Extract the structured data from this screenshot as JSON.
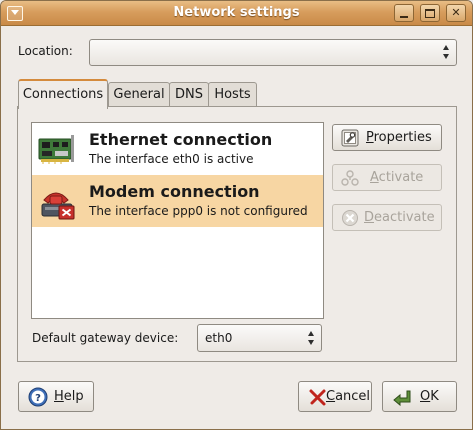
{
  "window": {
    "title": "Network settings"
  },
  "location": {
    "label": "Location:",
    "value": ""
  },
  "tabs": [
    {
      "label": "Connections",
      "active": true
    },
    {
      "label": "General",
      "active": false
    },
    {
      "label": "DNS",
      "active": false
    },
    {
      "label": "Hosts",
      "active": false
    }
  ],
  "connections": [
    {
      "title": "Ethernet connection",
      "status": "The interface eth0 is active",
      "icon": "network-card-icon",
      "selected": false
    },
    {
      "title": "Modem connection",
      "status": "The interface ppp0 is not configured",
      "icon": "modem-phone-icon",
      "selected": true
    }
  ],
  "side_buttons": {
    "properties": {
      "mnemonic": "P",
      "rest": "roperties",
      "enabled": true
    },
    "activate": {
      "mnemonic": "A",
      "rest": "ctivate",
      "enabled": false
    },
    "deactivate": {
      "mnemonic": "D",
      "rest": "eactivate",
      "enabled": false
    }
  },
  "gateway": {
    "label": "Default gateway device:",
    "value": "eth0"
  },
  "footer": {
    "help": {
      "mnemonic": "H",
      "rest": "elp"
    },
    "cancel": {
      "mnemonic": "C",
      "rest": "ancel"
    },
    "ok": {
      "mnemonic": "O",
      "rest": "K"
    }
  },
  "colors": {
    "titlebar": "#d79d5d",
    "selection": "#f7d6a3",
    "tab_accent": "#d48a3c"
  }
}
